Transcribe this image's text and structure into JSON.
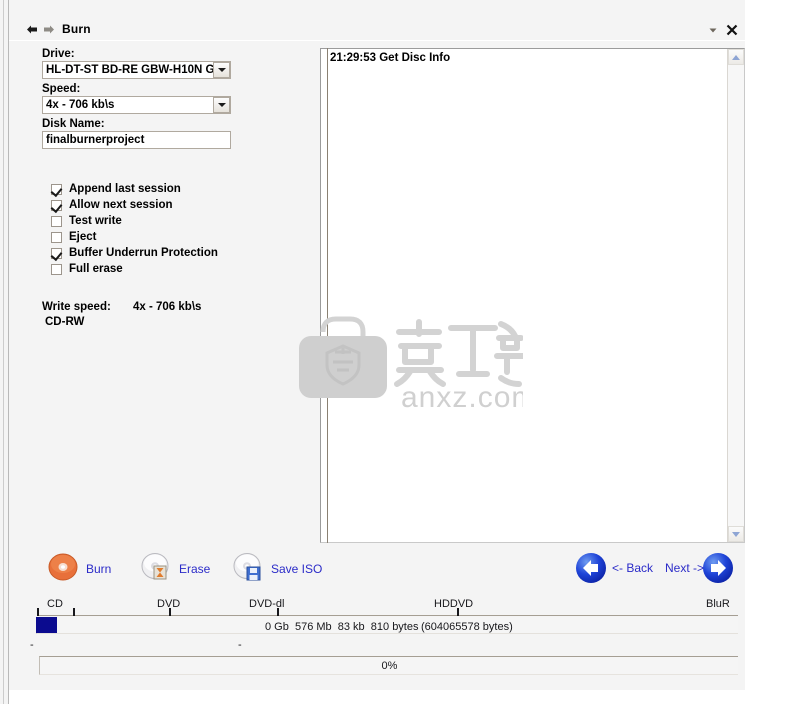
{
  "window": {
    "title": "Burn",
    "nav_back_icon": "arrow-left-icon",
    "nav_forward_icon": "arrow-right-icon",
    "collapse_icon": "chevron-down-icon",
    "close_icon": "close-icon"
  },
  "form": {
    "drive": {
      "label": "Drive:",
      "value": "HL-DT-ST BD-RE  GBW-H10N  G"
    },
    "speed": {
      "label": "Speed:",
      "value": "4x - 706 kb\\s"
    },
    "disk_name": {
      "label": "Disk Name:",
      "value": "finalburnerproject"
    },
    "options": [
      {
        "label": "Append  last session",
        "checked": true
      },
      {
        "label": "Allow next session",
        "checked": true
      },
      {
        "label": "Test write",
        "checked": false
      },
      {
        "label": "Eject",
        "checked": false
      },
      {
        "label": "Buffer Underrun Protection",
        "checked": true
      },
      {
        "label": "Full erase",
        "checked": false
      }
    ],
    "write_speed_label": "Write speed:",
    "write_speed_value": "4x - 706 kb\\s",
    "media_type": "CD-RW"
  },
  "log": {
    "lines": [
      "21:29:53 Get Disc Info"
    ]
  },
  "watermark": {
    "text_cn": "安下载",
    "text_url": "anxz.com",
    "color": "#d2d2d2"
  },
  "actions": [
    {
      "name": "burn",
      "label": "Burn",
      "icon": "burn-disc-icon"
    },
    {
      "name": "erase",
      "label": "Erase",
      "icon": "erase-disc-icon"
    },
    {
      "name": "save-iso",
      "label": "Save ISO",
      "icon": "save-iso-disc-icon"
    }
  ],
  "nav": {
    "back_label": "<- Back",
    "next_label": "Next ->",
    "back_icon": "circle-arrow-left-icon",
    "next_icon": "circle-arrow-right-icon"
  },
  "capacity": {
    "marks": [
      "CD",
      "DVD",
      "DVD-dl",
      "HDDVD",
      "BluR"
    ],
    "size_text": "0 Gb  576 Mb  83 kb  810 bytes",
    "bytes_text": "(604065578 bytes)",
    "fill_percent": 3,
    "fill_color": "#0b0b8f"
  },
  "status": {
    "left_dash": "-",
    "mid_dash": "-",
    "progress_label": "0%",
    "progress_percent": 0
  }
}
